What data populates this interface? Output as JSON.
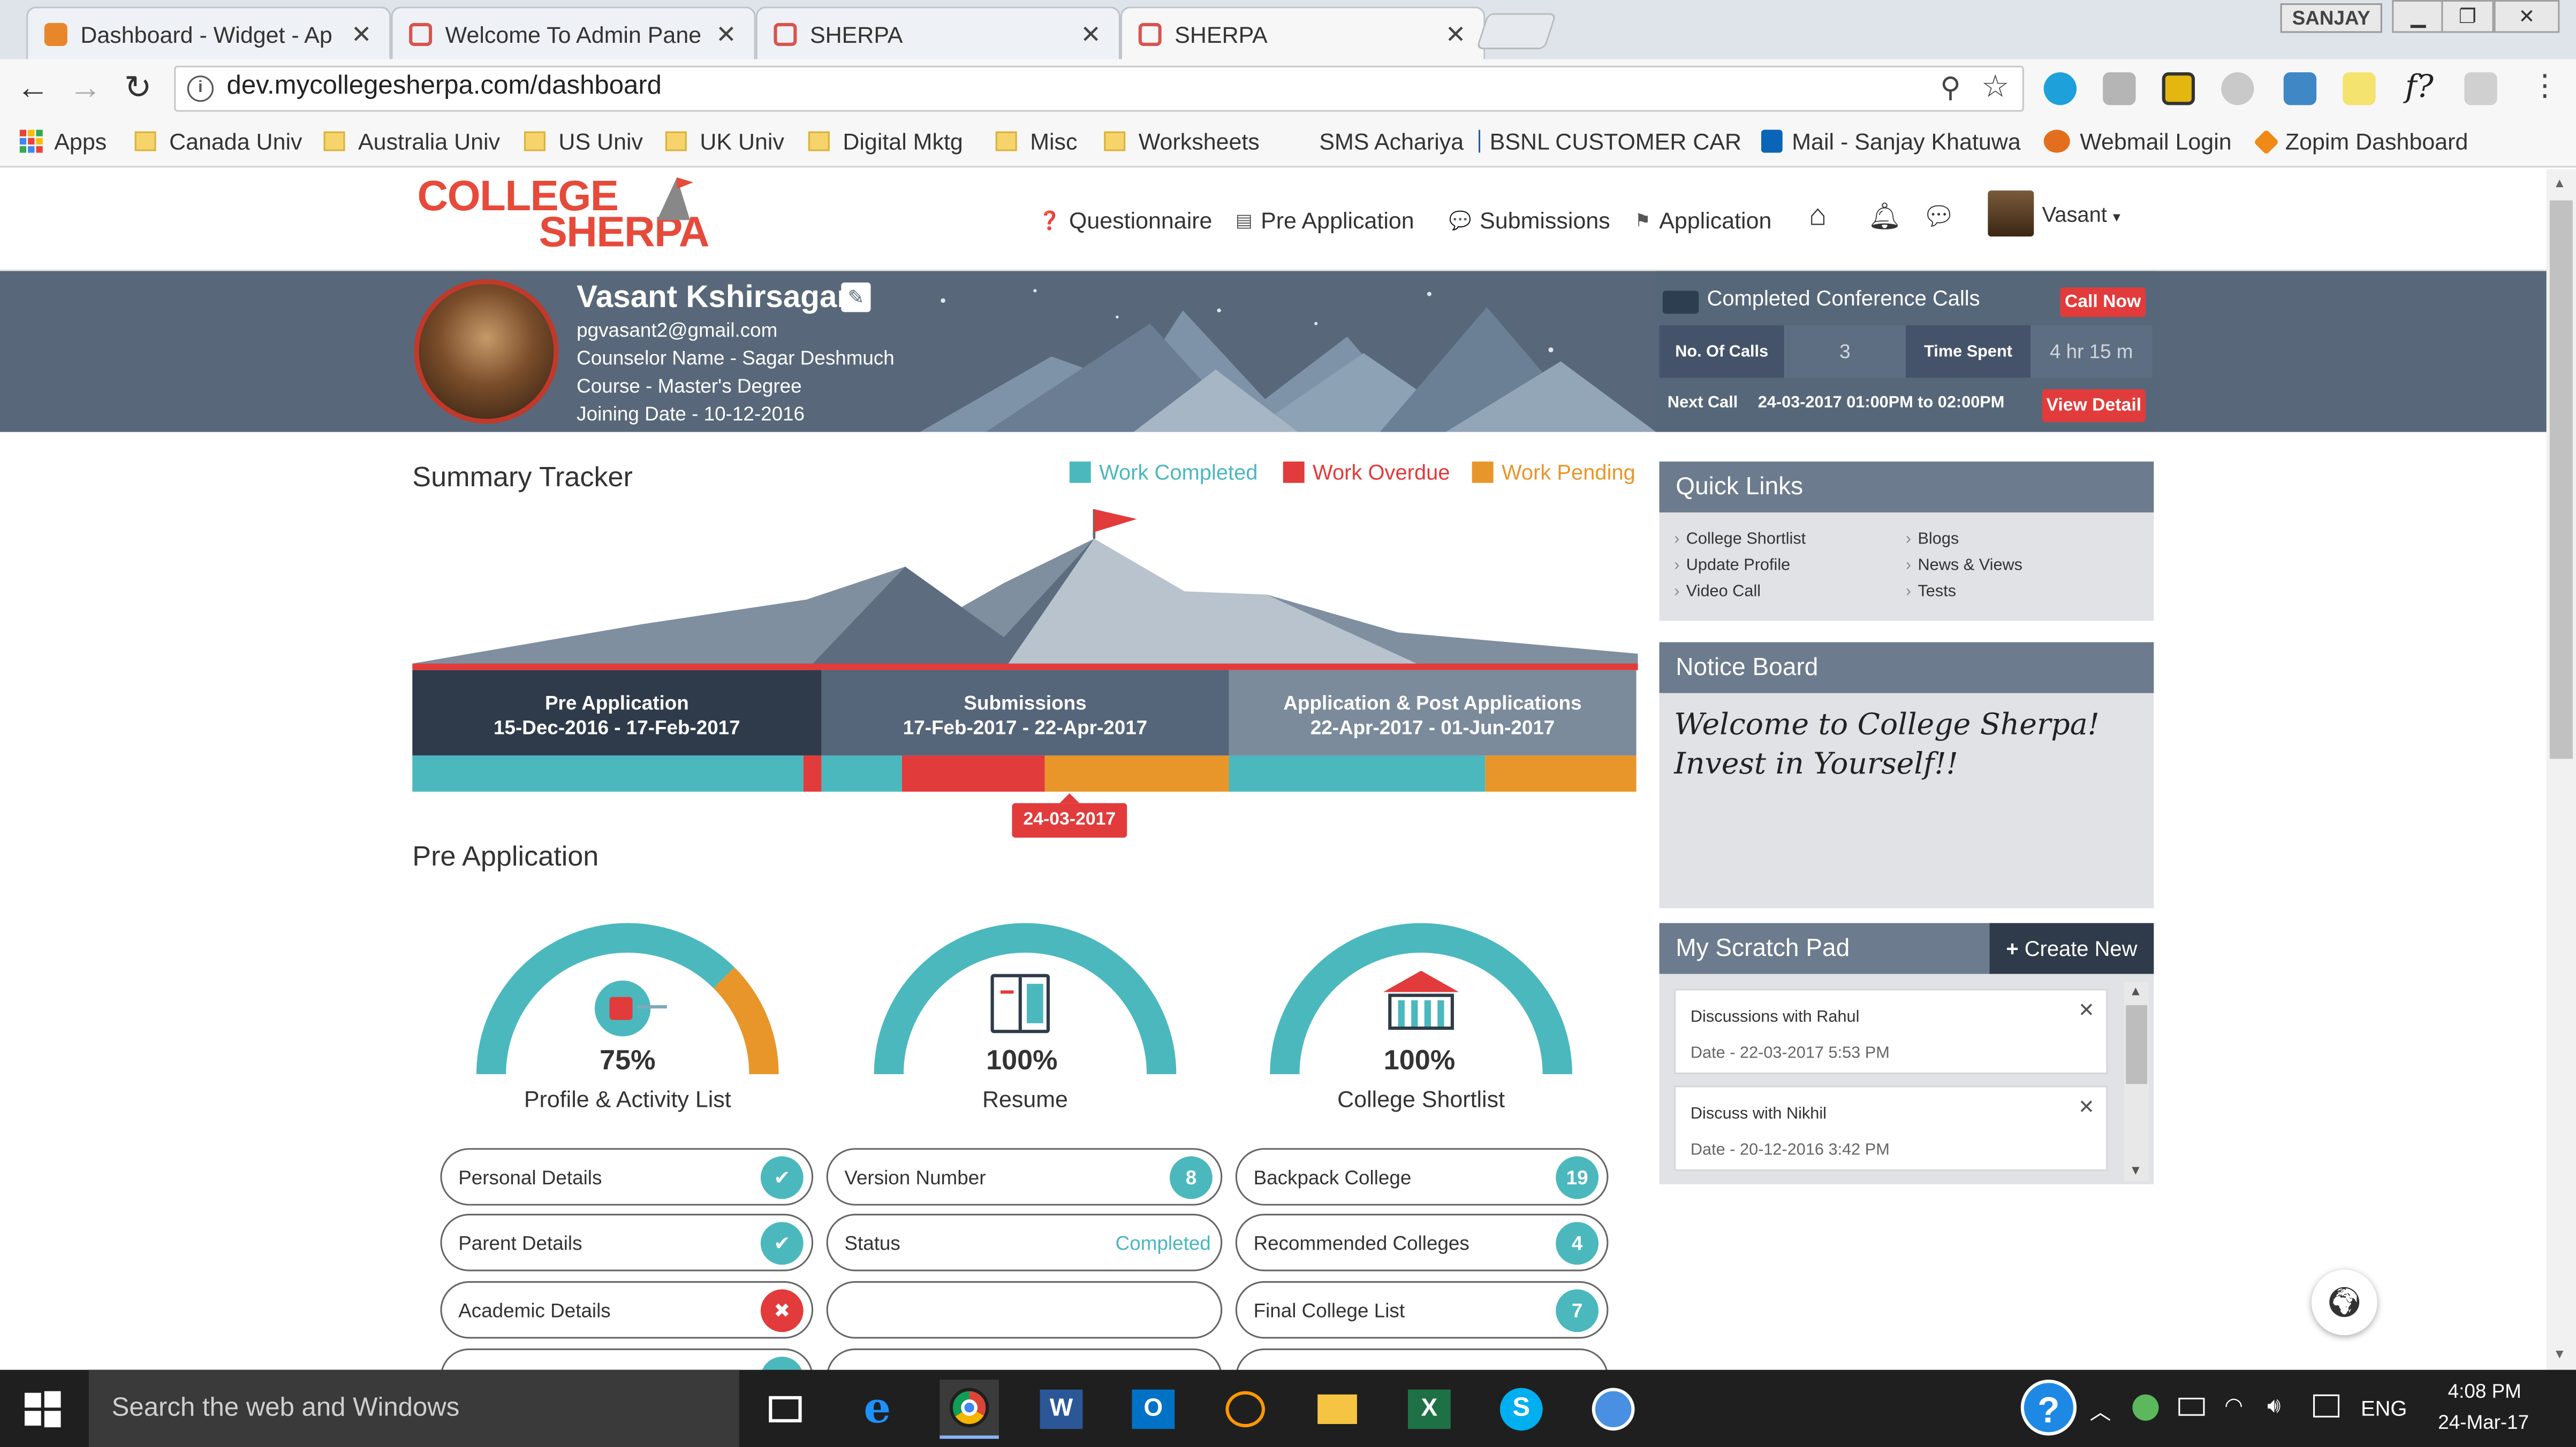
{
  "browser": {
    "tabs": [
      {
        "title": "Dashboard - Widget - Ap",
        "color": "#e8862a"
      },
      {
        "title": "Welcome To Admin Pane",
        "color": "#d9534f"
      },
      {
        "title": "SHERPA",
        "color": "#d9534f"
      },
      {
        "title": "SHERPA",
        "color": "#d9534f"
      }
    ],
    "profile": "SANJAY",
    "url": "dev.mycollegesherpa.com/dashboard",
    "bookmarks": [
      "Apps",
      "Canada Univ",
      "Australia Univ",
      "US Univ",
      "UK Univ",
      "Digital Mktg",
      "Misc",
      "Worksheets",
      "SMS Achariya",
      "BSNL CUSTOMER CAR",
      "Mail - Sanjay Khatuwa",
      "Webmail Login",
      "Zopim Dashboard"
    ]
  },
  "site": {
    "logo_line1": "COLLEGE",
    "logo_line2": "SHERPA",
    "nav": {
      "questionnaire": "Questionnaire",
      "pre_application": "Pre Application",
      "submissions": "Submissions",
      "application": "Application",
      "user": "Vasant"
    }
  },
  "profile": {
    "name": "Vasant Kshirsagar",
    "email": "pgvasant2@gmail.com",
    "counselor": "Counselor Name - Sagar Deshmuch",
    "course": "Course - Master's Degree",
    "joining": "Joining Date - 10-12-2016"
  },
  "conference": {
    "title": "Completed Conference Calls",
    "call_now": "Call Now",
    "calls_label": "No. Of Calls",
    "calls_value": "3",
    "time_label": "Time Spent",
    "time_value": "4 hr 15 m",
    "next_label": "Next Call",
    "next_value": "24-03-2017 01:00PM to 02:00PM",
    "view_detail": "View Detail"
  },
  "tracker": {
    "title": "Summary Tracker",
    "legend": {
      "completed": "Work Completed",
      "overdue": "Work Overdue",
      "pending": "Work Pending"
    },
    "colors": {
      "completed": "#4bb8be",
      "overdue": "#e23b3b",
      "pending": "#e8962a"
    },
    "phases": [
      {
        "name": "Pre Application",
        "dates": "15-Dec-2016 - 17-Feb-2017"
      },
      {
        "name": "Submissions",
        "dates": "17-Feb-2017 - 22-Apr-2017"
      },
      {
        "name": "Application & Post Applications",
        "dates": "22-Apr-2017 - 01-Jun-2017"
      }
    ],
    "current_date": "24-03-2017"
  },
  "pre_application": {
    "title": "Pre Application",
    "gauges": [
      {
        "pct": "75%",
        "value": 0.75,
        "label": "Profile & Activity List"
      },
      {
        "pct": "100%",
        "value": 1.0,
        "label": "Resume"
      },
      {
        "pct": "100%",
        "value": 1.0,
        "label": "College Shortlist"
      }
    ],
    "col1": [
      "Personal Details",
      "Parent Details",
      "Academic Details"
    ],
    "col2": {
      "version_label": "Version Number",
      "version_value": "8",
      "status_label": "Status",
      "status_value": "Completed"
    },
    "col3": [
      {
        "label": "Backpack College",
        "count": "19"
      },
      {
        "label": "Recommended Colleges",
        "count": "4"
      },
      {
        "label": "Final College List",
        "count": "7"
      }
    ]
  },
  "quick_links": {
    "title": "Quick Links",
    "left": [
      "College Shortlist",
      "Update Profile",
      "Video Call"
    ],
    "right": [
      "Blogs",
      "News & Views",
      "Tests"
    ]
  },
  "notice": {
    "title": "Notice Board",
    "line1": "Welcome to College Sherpa!",
    "line2": "Invest in Yourself!!"
  },
  "scratch": {
    "title": "My Scratch Pad",
    "create": "Create New",
    "items": [
      {
        "title": "Discussions with Rahul",
        "date": "Date - 22-03-2017 5:53 PM"
      },
      {
        "title": "Discuss with Nikhil",
        "date": "Date - 20-12-2016 3:42 PM"
      }
    ]
  },
  "taskbar": {
    "search_placeholder": "Search the web and Windows",
    "lang": "ENG",
    "time": "4:08 PM",
    "date": "24-Mar-17"
  }
}
